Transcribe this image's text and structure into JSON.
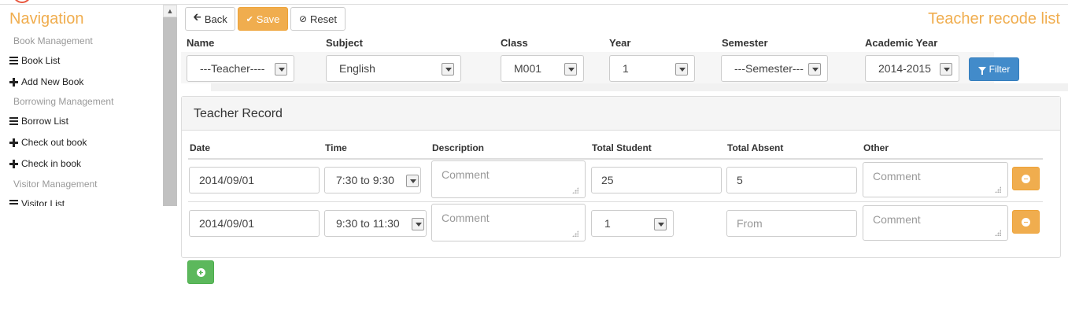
{
  "sidebar": {
    "title": "Navigation",
    "sections": [
      {
        "label": "Book Management",
        "items": [
          {
            "label": "Book List",
            "icon": "list-icon"
          },
          {
            "label": "Add New Book",
            "icon": "plus-icon"
          }
        ]
      },
      {
        "label": "Borrowing Management",
        "items": [
          {
            "label": "Borrow List",
            "icon": "list-icon"
          },
          {
            "label": "Check out book",
            "icon": "plus-icon"
          },
          {
            "label": "Check in book",
            "icon": "plus-icon"
          }
        ]
      },
      {
        "label": "Visitor Management",
        "items": [
          {
            "label": "Visitor List",
            "icon": "list-icon"
          }
        ]
      }
    ]
  },
  "toolbar": {
    "back_label": "Back",
    "save_label": "Save",
    "reset_label": "Reset"
  },
  "page_title": "Teacher recode list",
  "filters": {
    "labels": {
      "name": "Name",
      "subject": "Subject",
      "class": "Class",
      "year": "Year",
      "semester": "Semester",
      "academic_year": "Academic Year"
    },
    "values": {
      "name": "---Teacher----",
      "subject": "English",
      "class": "M001",
      "year": "1",
      "semester": "---Semester---",
      "academic_year": "2014-2015"
    },
    "filter_button": "Filter"
  },
  "panel": {
    "title": "Teacher Record",
    "columns": {
      "date": "Date",
      "time": "Time",
      "description": "Description",
      "total_student": "Total Student",
      "total_absent": "Total Absent",
      "other": "Other"
    },
    "rows": [
      {
        "date": "2014/09/01",
        "time": "7:30 to 9:30",
        "description_placeholder": "Comment",
        "total_student": "25",
        "total_absent": "5",
        "other_placeholder": "Comment"
      },
      {
        "date": "2014/09/01",
        "time": "9:30 to 11:30",
        "description_placeholder": "Comment",
        "total_student": "1",
        "total_absent_placeholder": "From",
        "other_placeholder": "Comment"
      }
    ]
  },
  "colors": {
    "accent_orange": "#f0ad4e",
    "primary_blue": "#428bca",
    "success_green": "#5cb85c"
  }
}
